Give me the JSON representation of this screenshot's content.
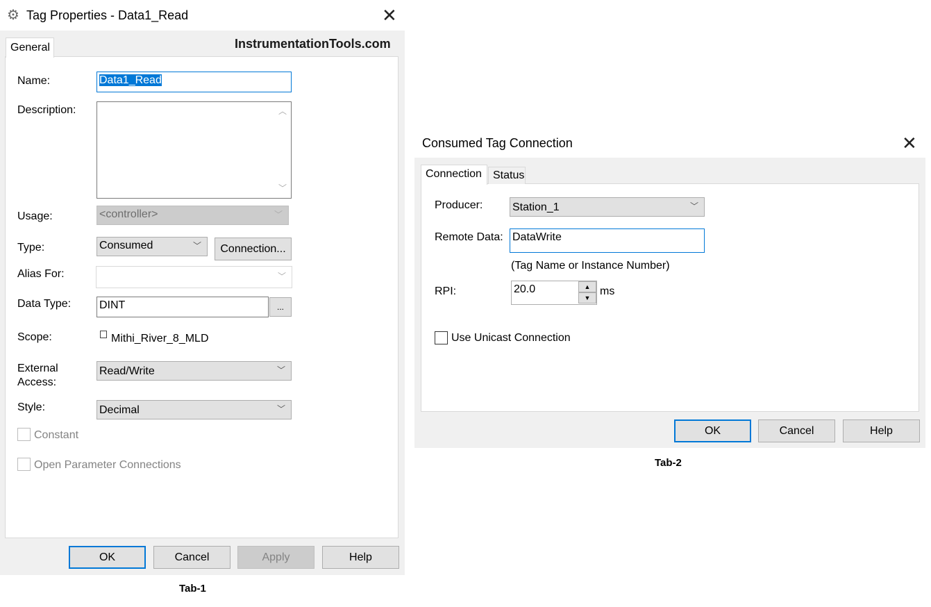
{
  "tag_properties": {
    "title": "Tag Properties - Data1_Read",
    "watermark": "InstrumentationTools.com",
    "tabs": [
      {
        "label": "General"
      }
    ],
    "name_label": "Name:",
    "name_value": "Data1_Read",
    "description_label": "Description:",
    "description_value": "",
    "usage_label": "Usage:",
    "usage_value": "<controller>",
    "type_label": "Type:",
    "type_value": "Consumed",
    "connection_button": "Connection...",
    "alias_label": "Alias For:",
    "alias_value": "",
    "data_type_label": "Data Type:",
    "data_type_value": "DINT",
    "browse_button": "...",
    "scope_label": "Scope:",
    "scope_value": "Mithi_River_8_MLD",
    "external_access_label_1": "External",
    "external_access_label_2": "Access:",
    "external_access_value": "Read/Write",
    "style_label": "Style:",
    "style_value": "Decimal",
    "constant_label": "Constant",
    "constant_checked": false,
    "open_param_label": "Open Parameter Connections",
    "open_param_checked": false,
    "buttons": {
      "ok": "OK",
      "cancel": "Cancel",
      "apply": "Apply",
      "help": "Help"
    },
    "caption": "Tab-1"
  },
  "consumed_connection": {
    "title": "Consumed Tag Connection",
    "tabs": [
      {
        "label": "Connection",
        "active": true
      },
      {
        "label": "Status",
        "active": false
      }
    ],
    "producer_label": "Producer:",
    "producer_value": "Station_1",
    "remote_data_label": "Remote Data:",
    "remote_data_value": "DataWrite",
    "remote_data_hint": "(Tag Name or Instance Number)",
    "rpi_label": "RPI:",
    "rpi_value": "20.0",
    "rpi_unit": "ms",
    "unicast_label": "Use Unicast Connection",
    "unicast_checked": false,
    "buttons": {
      "ok": "OK",
      "cancel": "Cancel",
      "help": "Help"
    },
    "caption": "Tab-2"
  },
  "colors": {
    "accent": "#0078d7",
    "dialog_bg": "#f0f0f0",
    "button_bg": "#e1e1e1"
  }
}
